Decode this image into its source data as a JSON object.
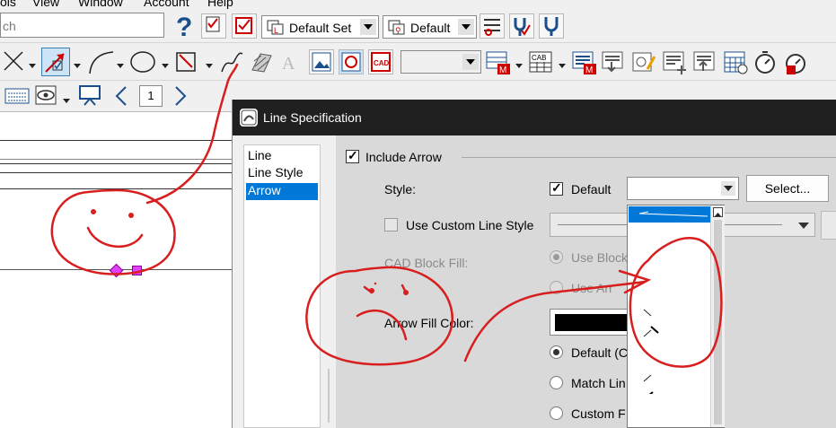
{
  "menubar": {
    "items": [
      "ols",
      "View",
      "Window",
      "Account",
      "Help"
    ]
  },
  "toolbar1": {
    "search_placeholder": "ch",
    "help_icon": "question-icon",
    "set_combo": "Default Set",
    "layer_combo": "Default"
  },
  "toolbar3": {
    "page_number": "1"
  },
  "dialog": {
    "title": "Line Specification",
    "nav_items": [
      {
        "label": "Line",
        "selected": false
      },
      {
        "label": "Line Style",
        "selected": false
      },
      {
        "label": "Arrow",
        "selected": true
      }
    ],
    "include_arrow": {
      "label": "Include Arrow",
      "checked": true
    },
    "style_label": "Style:",
    "default_check": {
      "label": "Default",
      "checked": true
    },
    "select_button": "Select...",
    "use_custom_line_style": {
      "label": "Use Custom Line Style",
      "checked": false
    },
    "cad_block_fill_label": "CAD Block Fill:",
    "cad_options": [
      "Use Block",
      "Use Arr"
    ],
    "arrow_fill_color_label": "Arrow Fill Color:",
    "arrow_fill_color": "#000000",
    "fill_options": [
      {
        "label": "Default (C",
        "selected": true
      },
      {
        "label": "Match Lin",
        "selected": false
      },
      {
        "label": "Custom F",
        "selected": false
      }
    ]
  },
  "annotations": {
    "ink_color": "#d81e1e"
  }
}
